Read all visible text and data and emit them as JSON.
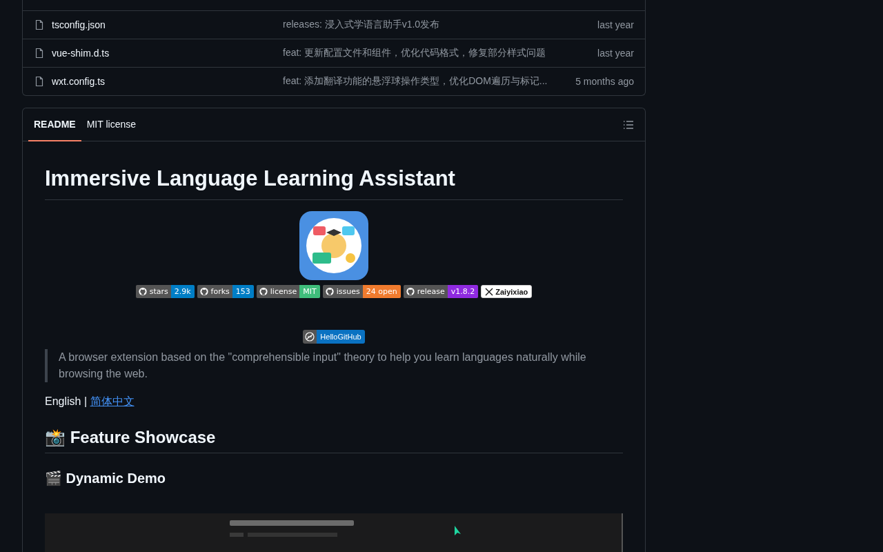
{
  "files": [
    {
      "name": "tsconfig.json",
      "message": "releases: 浸入式学语言助手v1.0发布",
      "time": "last year"
    },
    {
      "name": "vue-shim.d.ts",
      "message": "feat: 更新配置文件和组件，优化代码格式，修复部分样式问题",
      "time": "last year"
    },
    {
      "name": "wxt.config.ts",
      "message": "feat: 添加翻译功能的悬浮球操作类型，优化DOM遍历与标记...",
      "time": "5 months ago"
    }
  ],
  "readme_tabs": [
    {
      "label": "README",
      "selected": true
    },
    {
      "label": "MIT license",
      "selected": false
    }
  ],
  "readme": {
    "title": "Immersive Language Learning Assistant",
    "badges": [
      {
        "kind": "github",
        "label": "stars",
        "value": "2.9k",
        "color": "#007ec6"
      },
      {
        "kind": "github",
        "label": "forks",
        "value": "153",
        "color": "#007ec6"
      },
      {
        "kind": "github",
        "label": "license",
        "value": "MIT",
        "color": "#3fbd7b"
      },
      {
        "kind": "github",
        "label": "issues",
        "value": "24 open",
        "color": "#f07b2e"
      },
      {
        "kind": "github",
        "label": "release",
        "value": "v1.8.2",
        "color": "#8f2ae0"
      },
      {
        "kind": "x",
        "value": "Zaiyixiao"
      }
    ],
    "hellogithub": "HelloGitHub",
    "quote": "A browser extension based on the \"comprehensible input\" theory to help you learn languages naturally while browsing the web.",
    "lang_current": "English |",
    "lang_link": "简体中文",
    "h2": "📸 Feature Showcase",
    "h3": "🎬 Dynamic Demo"
  }
}
